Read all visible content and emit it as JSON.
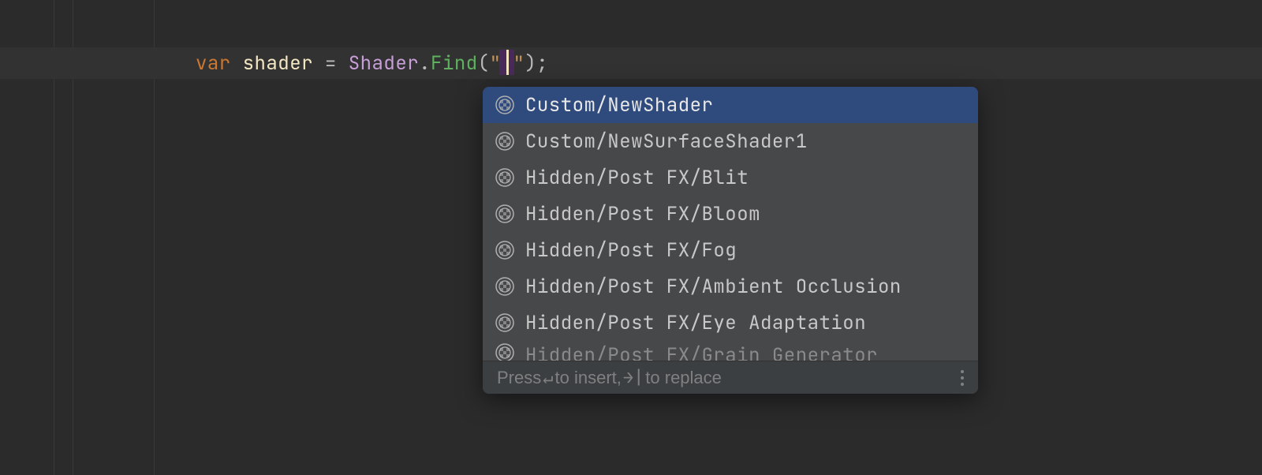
{
  "code": {
    "keyword": "var",
    "identifier": "shader",
    "equals": "=",
    "type": "Shader",
    "dot": ".",
    "method": "Find",
    "openParen": "(",
    "quote1": "\"",
    "quote2": "\"",
    "closeParen": ")",
    "semicolon": ";"
  },
  "completion": {
    "items": [
      {
        "label": "Custom/NewShader",
        "selected": true
      },
      {
        "label": "Custom/NewSurfaceShader1",
        "selected": false
      },
      {
        "label": "Hidden/Post FX/Blit",
        "selected": false
      },
      {
        "label": "Hidden/Post FX/Bloom",
        "selected": false
      },
      {
        "label": "Hidden/Post FX/Fog",
        "selected": false
      },
      {
        "label": "Hidden/Post FX/Ambient Occlusion",
        "selected": false
      },
      {
        "label": "Hidden/Post FX/Eye Adaptation",
        "selected": false
      },
      {
        "label": "Hidden/Post FX/Grain Generator",
        "selected": false
      }
    ],
    "footer": {
      "press": "Press ",
      "enterKey": "↵",
      "toInsert": " to insert, ",
      "tabKey": "→|",
      "toReplace": " to replace"
    }
  }
}
